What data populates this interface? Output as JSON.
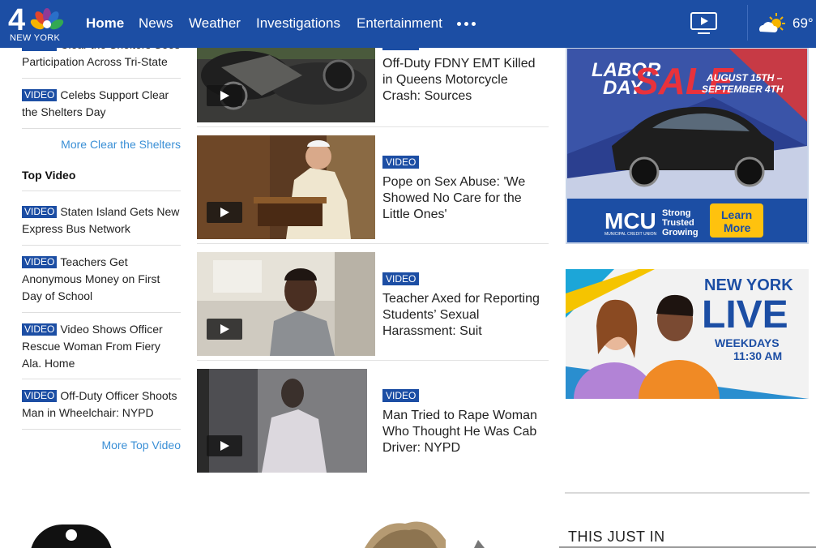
{
  "nav": {
    "logo_number": "4",
    "logo_text": "NEW YORK",
    "links": [
      "Home",
      "News",
      "Weather",
      "Investigations",
      "Entertainment"
    ],
    "active": "Home",
    "more_icon": "ellipsis-icon",
    "video_icon": "tv-play-icon",
    "weather_icon": "partly-sunny-icon",
    "temperature": "69°",
    "brand_color": "#1c4ea4"
  },
  "left": {
    "badge_label": "VIDEO",
    "clear_shelters": [
      {
        "title": "Clear the Shelters Sees Participation Across Tri-State"
      },
      {
        "title": "Celebs Support Clear the Shelters Day"
      }
    ],
    "clear_more": "More Clear the Shelters",
    "top_video_heading": "Top Video",
    "top_video": [
      {
        "title": "Staten Island Gets New Express Bus Network"
      },
      {
        "title": "Teachers Get Anonymous Money on First Day of School"
      },
      {
        "title": "Video Shows Officer Rescue Woman From Fiery Ala. Home"
      },
      {
        "title": "Off-Duty Officer Shoots Man in Wheelchair: NYPD"
      }
    ],
    "top_more": "More Top Video"
  },
  "middle": {
    "badge_label": "VIDEO",
    "items": [
      {
        "headline": "Off-Duty FDNY EMT Killed in Queens Motorcycle Crash: Sources"
      },
      {
        "headline": "Pope on Sex Abuse: 'We Showed No Care for the Little Ones'"
      },
      {
        "headline": "Teacher Axed for Reporting Students’ Sexual Harassment: Suit"
      },
      {
        "headline": "Man Tried to Rape Woman Who Thought He Was Cab Driver: NYPD"
      }
    ]
  },
  "ads": {
    "labor_day": {
      "line1": "LABOR",
      "line2": "DAY",
      "sale": "SALE",
      "dates1": "AUGUST 15TH –",
      "dates2": "SEPTEMBER 4TH",
      "mcu": "MCU",
      "mcu_sub": "MUNICIPAL CREDIT UNION",
      "tag1": "Strong",
      "tag2": "Trusted",
      "tag3": "Growing",
      "cta1": "Learn",
      "cta2": "More"
    },
    "ny_live": {
      "line1": "NEW YORK",
      "line2": "LIVE",
      "line3": "WEEKDAYS",
      "line4": "11:30 AM"
    }
  },
  "this_just_in": "THIS JUST IN"
}
